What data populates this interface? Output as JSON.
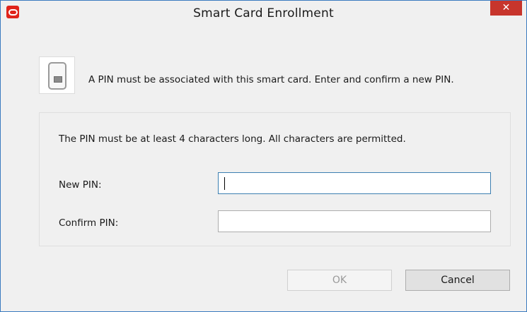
{
  "window": {
    "title": "Smart Card Enrollment",
    "app_icon": "oracle-o-icon",
    "close_glyph": "✕"
  },
  "header": {
    "icon": "smart-card-icon",
    "message": "A PIN must be associated with this smart card. Enter and confirm a new PIN."
  },
  "pin_group": {
    "requirement_text": "The PIN must be at least 4 characters long. All characters are permitted.",
    "new_pin": {
      "label": "New PIN:",
      "value": "",
      "focused": true
    },
    "confirm_pin": {
      "label": "Confirm PIN:",
      "value": ""
    }
  },
  "buttons": {
    "ok_label": "OK",
    "ok_enabled": false,
    "cancel_label": "Cancel"
  },
  "colors": {
    "window_border": "#3b7bbf",
    "close_button": "#c7352c",
    "app_icon": "#e0241b",
    "background": "#f0f0f0"
  }
}
